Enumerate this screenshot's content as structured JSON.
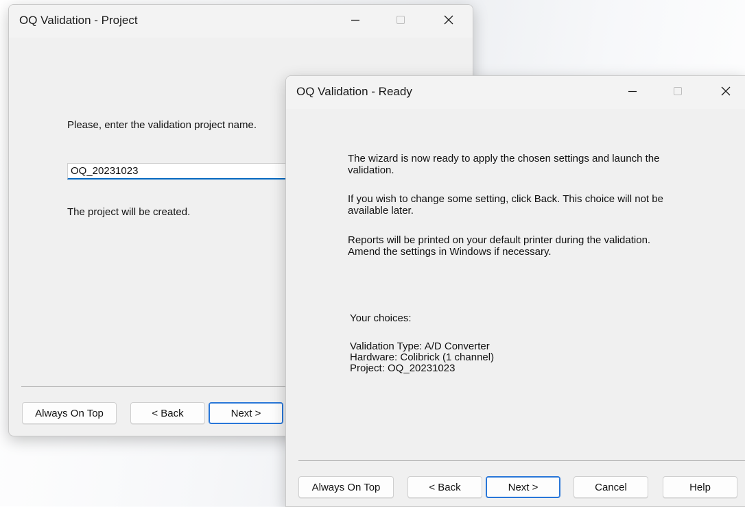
{
  "project_window": {
    "title": "OQ Validation - Project",
    "prompt": "Please, enter the validation project name.",
    "project_name_value": "OQ_20231023",
    "info": "The project will be created.",
    "buttons": {
      "always_on_top": "Always On Top",
      "back": "< Back",
      "next": "Next >"
    }
  },
  "ready_window": {
    "title": "OQ Validation - Ready",
    "paragraphs": [
      "The wizard is now ready to apply the chosen settings and launch the",
      "validation.",
      "If you wish to change some setting, click Back. This choice will not be",
      "available later.",
      "Reports will be printed on your default printer during the validation.",
      "Amend the settings in Windows if necessary."
    ],
    "choices_heading": "Your choices:",
    "choices": [
      "Validation Type: A/D Converter",
      "Hardware: Colibrick (1 channel)",
      "Project: OQ_20231023"
    ],
    "buttons": {
      "always_on_top": "Always On Top",
      "back": "< Back",
      "next": "Next >",
      "cancel": "Cancel",
      "help": "Help"
    }
  },
  "icons": {
    "minimize": "minimize-icon",
    "maximize": "maximize-icon",
    "close": "close-icon"
  },
  "colors": {
    "accent": "#0067c0",
    "default_button_border": "#2876d8",
    "window_bg": "#f0f0f0"
  }
}
